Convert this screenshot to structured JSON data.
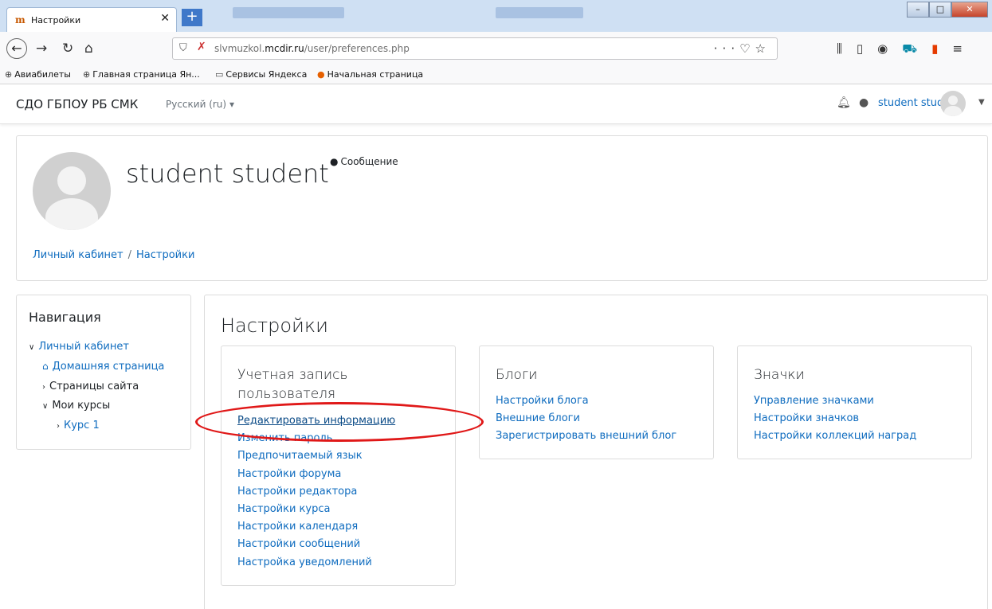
{
  "browser": {
    "tab_title": "Настройки",
    "tab_close": "✕",
    "new_tab": "+",
    "url_domain_prefix": "slvmuzkol.",
    "url_domain_main": "mcdir.ru",
    "url_path": "/user/preferences.php",
    "bookmarks": [
      {
        "label": "Авиабилеты",
        "icon": "globe-icon"
      },
      {
        "label": "Главная страница Ян...",
        "icon": "globe-icon"
      },
      {
        "label": "Сервисы Яндекса",
        "icon": "folder-icon"
      },
      {
        "label": "Начальная страница",
        "icon": "firefox-icon"
      }
    ]
  },
  "header": {
    "site_name": "СДО ГБПОУ РБ СМК",
    "language": "Русский (ru)",
    "user_name": "student student"
  },
  "page_header": {
    "full_name": "student student",
    "message_label": "Сообщение",
    "breadcrumb": [
      "Личный кабинет",
      "Настройки"
    ]
  },
  "navigation": {
    "title": "Навигация",
    "items": [
      {
        "label": "Личный кабинет"
      },
      {
        "label": "Домашняя страница"
      },
      {
        "label": "Страницы сайта"
      },
      {
        "label": "Мои курсы"
      },
      {
        "label": "Курс 1"
      }
    ]
  },
  "main": {
    "title": "Настройки",
    "cards": [
      {
        "title_line1": "Учетная запись",
        "title_line2": "пользователя",
        "links": [
          "Редактировать информацию",
          "Изменить пароль",
          "Предпочитаемый язык",
          "Настройки форума",
          "Настройки редактора",
          "Настройки курса",
          "Настройки календаря",
          "Настройки сообщений",
          "Настройка уведомлений"
        ]
      },
      {
        "title": "Блоги",
        "links": [
          "Настройки блога",
          "Внешние блоги",
          "Зарегистрировать внешний блог"
        ]
      },
      {
        "title": "Значки",
        "links": [
          "Управление значками",
          "Настройки значков",
          "Настройки коллекций наград"
        ]
      }
    ]
  },
  "colors": {
    "link": "#0f6cbf",
    "highlight": "#e01818",
    "text": "#1d2125"
  }
}
